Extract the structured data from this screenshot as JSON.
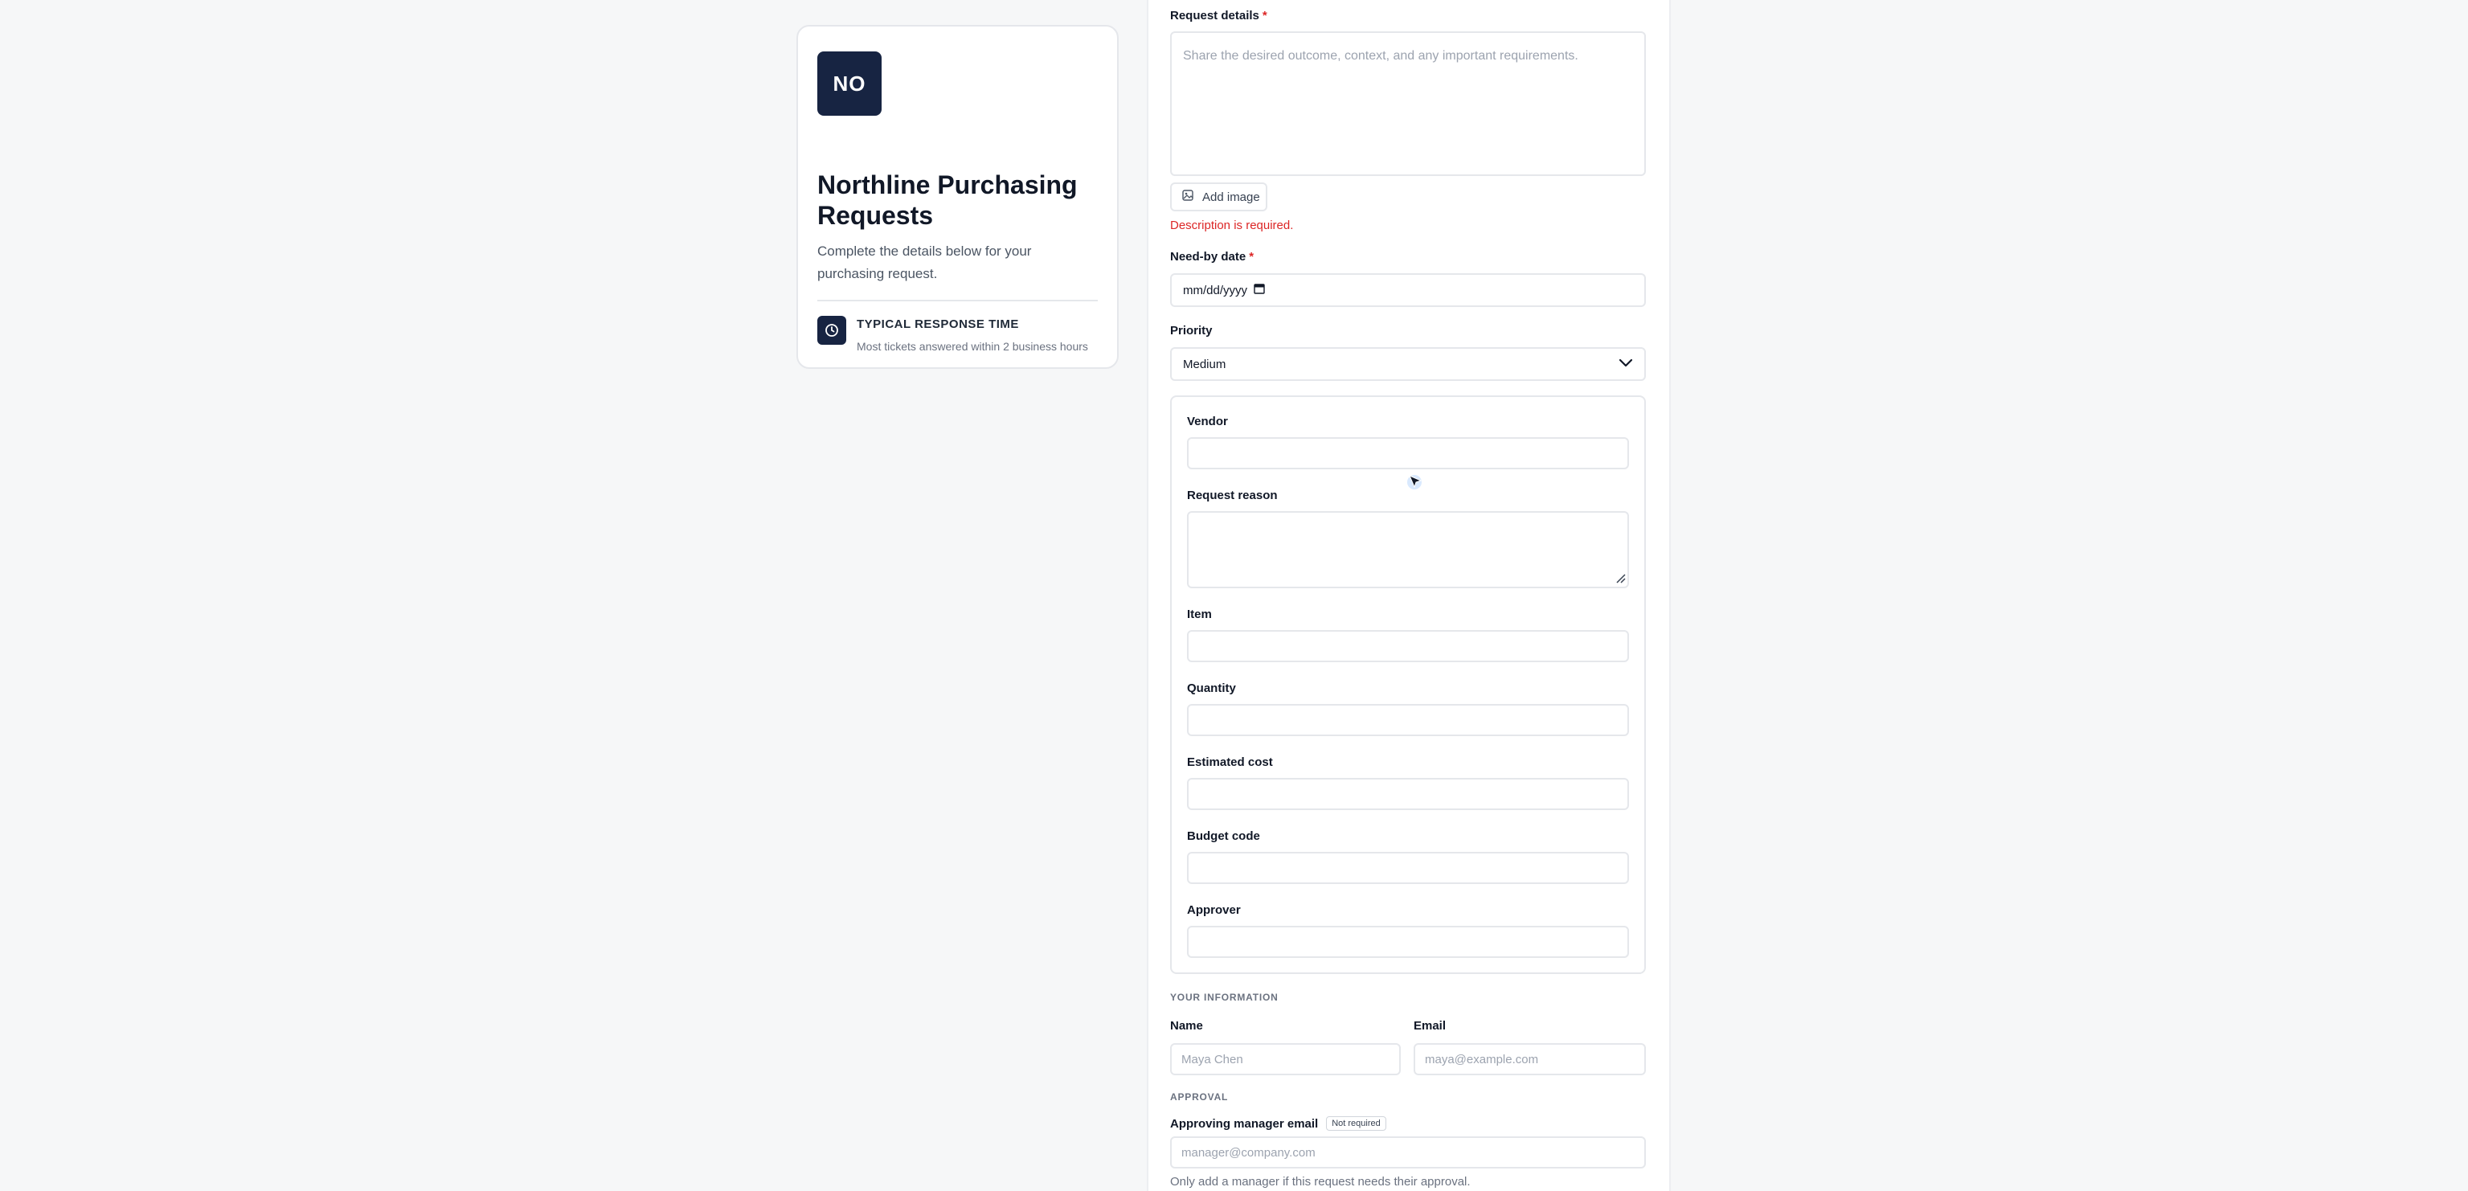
{
  "sidebar": {
    "logo_initials": "NO",
    "title": "Northline Purchasing Requests",
    "description": "Complete the details below for your purchasing request.",
    "response": {
      "title": "TYPICAL RESPONSE TIME",
      "text": "Most tickets answered within 2 business hours"
    }
  },
  "form": {
    "request_details": {
      "label": "Request details",
      "required_mark": "*",
      "placeholder": "Share the desired outcome, context, and any important requirements.",
      "add_image_label": "Add image",
      "error": "Description is required."
    },
    "need_by": {
      "label": "Need-by date",
      "required_mark": "*",
      "placeholder": "mm/dd/yyyy"
    },
    "priority": {
      "label": "Priority",
      "value": "Medium"
    },
    "details": {
      "vendor_label": "Vendor",
      "reason_label": "Request reason",
      "item_label": "Item",
      "quantity_label": "Quantity",
      "cost_label": "Estimated cost",
      "budget_label": "Budget code",
      "approver_label": "Approver"
    },
    "your_info": {
      "section": "YOUR INFORMATION",
      "name_label": "Name",
      "name_placeholder": "Maya Chen",
      "email_label": "Email",
      "email_placeholder": "maya@example.com"
    },
    "approval": {
      "section": "APPROVAL",
      "manager_label": "Approving manager email",
      "badge": "Not required",
      "manager_placeholder": "manager@company.com",
      "help": "Only add a manager if this request needs their approval."
    }
  },
  "colors": {
    "brand": "#172442",
    "error": "#dc2626",
    "border": "#e5e7eb",
    "background": "#f6f7f8"
  },
  "icons": {
    "clock": "clock-icon",
    "image": "image-icon",
    "calendar": "calendar-icon",
    "chevron": "chevron-down-icon"
  }
}
